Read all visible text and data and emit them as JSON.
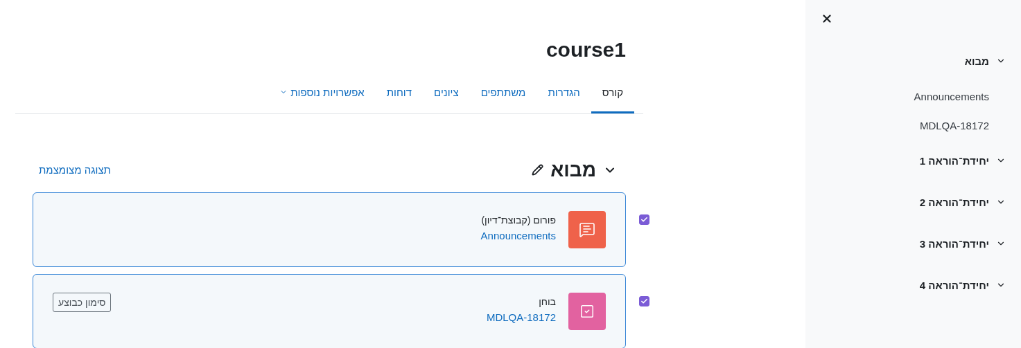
{
  "page": {
    "title": "course1"
  },
  "tabs": [
    {
      "label": "קורס",
      "selected": true,
      "kind": "tab"
    },
    {
      "label": "הגדרות",
      "selected": false,
      "kind": "tab"
    },
    {
      "label": "משתתפים",
      "selected": false,
      "kind": "tab"
    },
    {
      "label": "ציונים",
      "selected": false,
      "kind": "tab"
    },
    {
      "label": "דוחות",
      "selected": false,
      "kind": "tab"
    },
    {
      "label": "אפשרויות נוספות",
      "selected": false,
      "kind": "menu"
    }
  ],
  "section": {
    "title": "מבוא",
    "expanded": true,
    "collapse_link": "תצוגה מצומצמת"
  },
  "activities": [
    {
      "kind": "forum",
      "kind_label": "פורום (קבוצת־דיון)",
      "name": "Announcements",
      "checked": true
    },
    {
      "kind": "quiz",
      "kind_label": "בוחן",
      "name": "MDLQA-18172",
      "checked": true,
      "action": "סימון כבוצע"
    }
  ],
  "drawer": {
    "sections": [
      {
        "title": "מבוא",
        "expanded": true,
        "children": [
          {
            "label": "Announcements"
          },
          {
            "label": "MDLQA-18172"
          }
        ]
      },
      {
        "title": "יחידת־הוראה 1",
        "expanded": true
      },
      {
        "title": "יחידת־הוראה 2",
        "expanded": true
      },
      {
        "title": "יחידת־הוראה 3",
        "expanded": true
      },
      {
        "title": "יחידת־הוראה 4",
        "expanded": true
      }
    ]
  }
}
